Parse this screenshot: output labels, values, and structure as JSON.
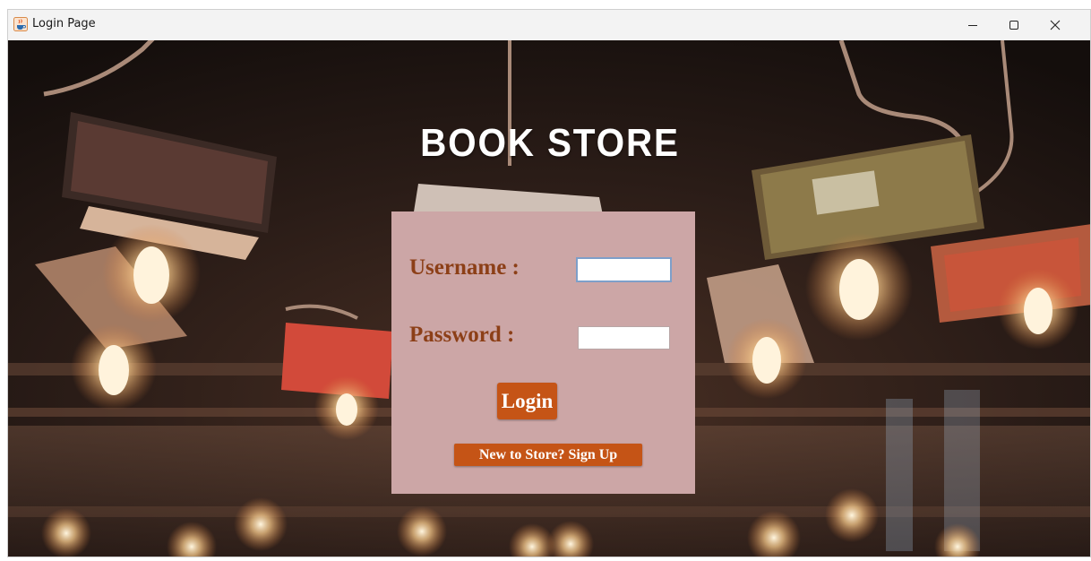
{
  "window": {
    "title": "Login Page",
    "app_icon": "java-cup-icon",
    "controls": {
      "minimize": "minimize-icon",
      "maximize": "maximize-icon",
      "close": "close-icon"
    }
  },
  "heading": "BOOK STORE",
  "form": {
    "username_label": "Username :",
    "password_label": "Password :",
    "username_value": "",
    "password_value": "",
    "login_label": "Login",
    "signup_label": "New to Store? Sign Up"
  },
  "colors": {
    "panel": "#cca6a6",
    "label_text": "#8c3f17",
    "button": "#c55416",
    "button_text": "#ffffff"
  }
}
